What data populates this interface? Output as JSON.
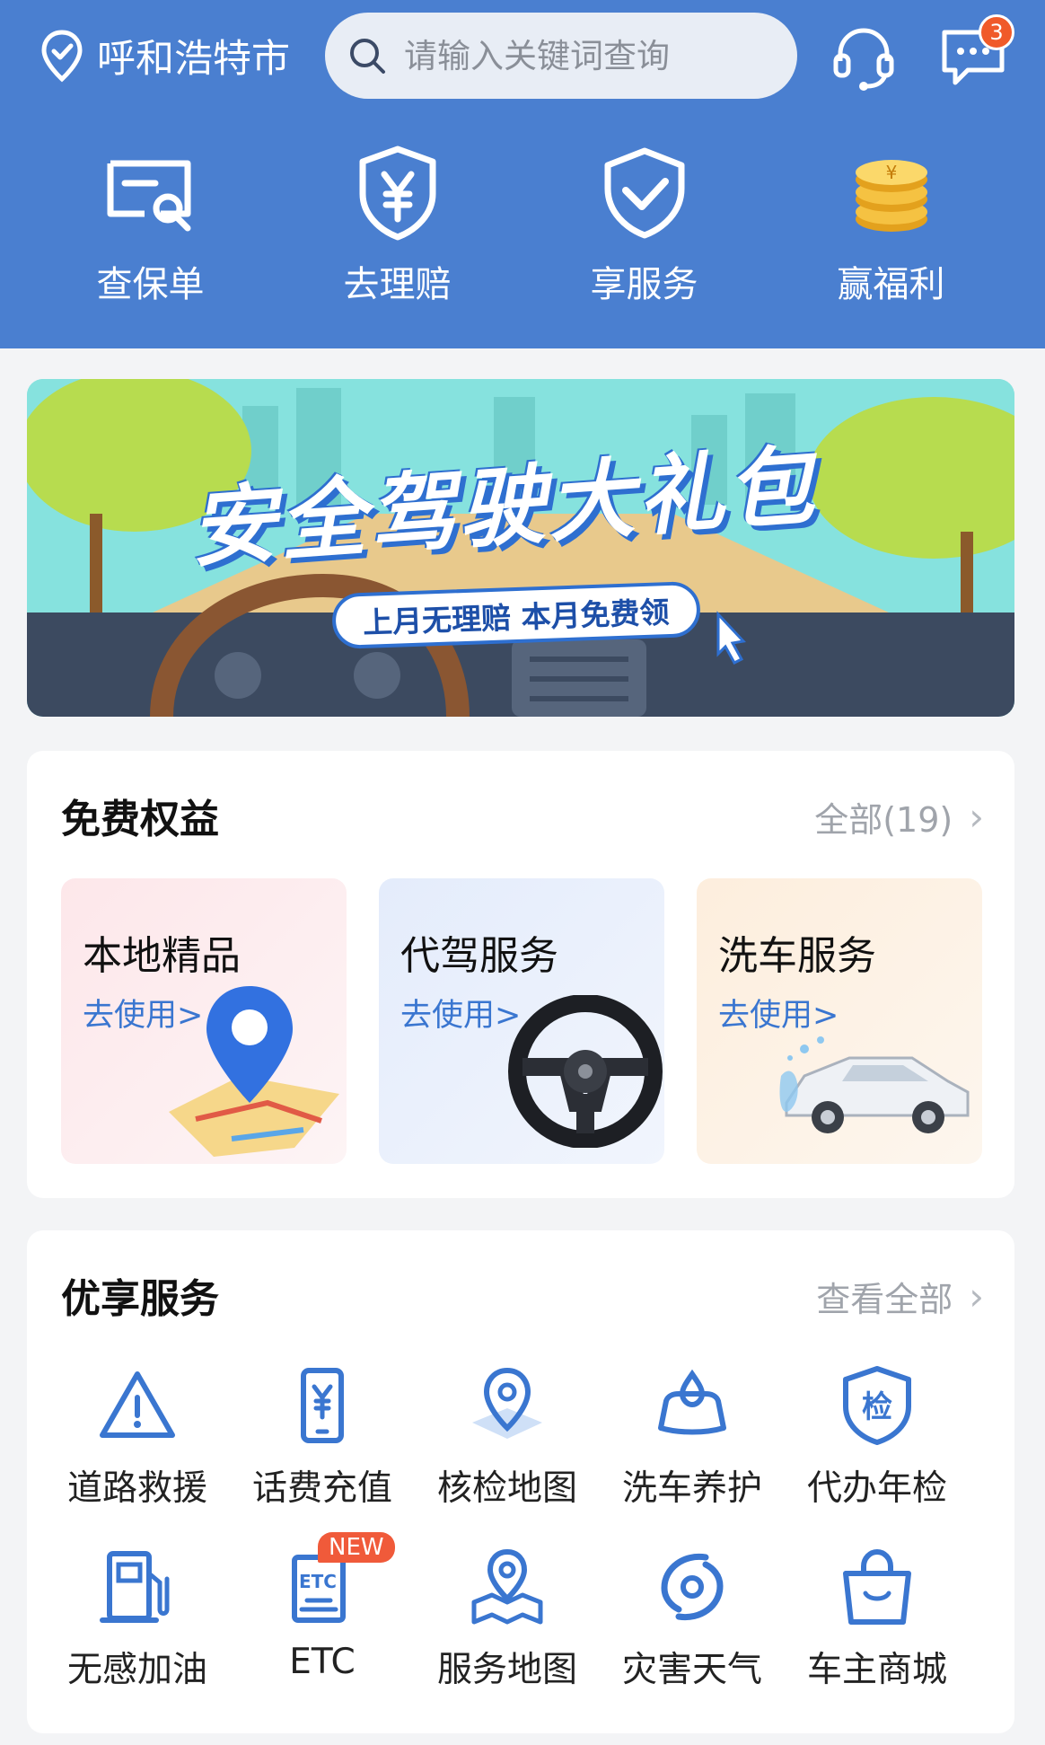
{
  "header": {
    "city": "呼和浩特市",
    "search_placeholder": "请输入关键词查询",
    "message_badge": "3",
    "quick": [
      {
        "label": "查保单",
        "icon": "policy-search-icon"
      },
      {
        "label": "去理赔",
        "icon": "claim-shield-icon"
      },
      {
        "label": "享服务",
        "icon": "service-check-icon"
      },
      {
        "label": "赢福利",
        "icon": "coin-stack-icon"
      }
    ]
  },
  "banner": {
    "title": "安全驾驶大礼包",
    "pill": "上月无理赔 本月免费领"
  },
  "benefits": {
    "title": "免费权益",
    "more": "全部(19)",
    "items": [
      {
        "title": "本地精品",
        "action": "去使用>",
        "icon": "map-pin-icon"
      },
      {
        "title": "代驾服务",
        "action": "去使用>",
        "icon": "steering-wheel-icon"
      },
      {
        "title": "洗车服务",
        "action": "去使用>",
        "icon": "car-wash-icon"
      }
    ]
  },
  "services": {
    "title": "优享服务",
    "more": "查看全部",
    "new_tag": "NEW",
    "items": [
      {
        "label": "道路救援",
        "icon": "warning-triangle-icon"
      },
      {
        "label": "话费充值",
        "icon": "phone-yen-icon"
      },
      {
        "label": "核检地图",
        "icon": "map-location-icon"
      },
      {
        "label": "洗车养护",
        "icon": "car-care-icon"
      },
      {
        "label": "代办年检",
        "icon": "inspection-badge-icon"
      },
      {
        "label": "无感加油",
        "icon": "fuel-pump-icon"
      },
      {
        "label": "ETC",
        "icon": "etc-card-icon"
      },
      {
        "label": "服务地图",
        "icon": "service-map-icon"
      },
      {
        "label": "灾害天气",
        "icon": "typhoon-icon"
      },
      {
        "label": "车主商城",
        "icon": "shopping-bag-icon"
      }
    ]
  },
  "colors": {
    "brand": "#4a7fd0",
    "accent": "#3a76d0",
    "badge": "#f05a2a"
  }
}
